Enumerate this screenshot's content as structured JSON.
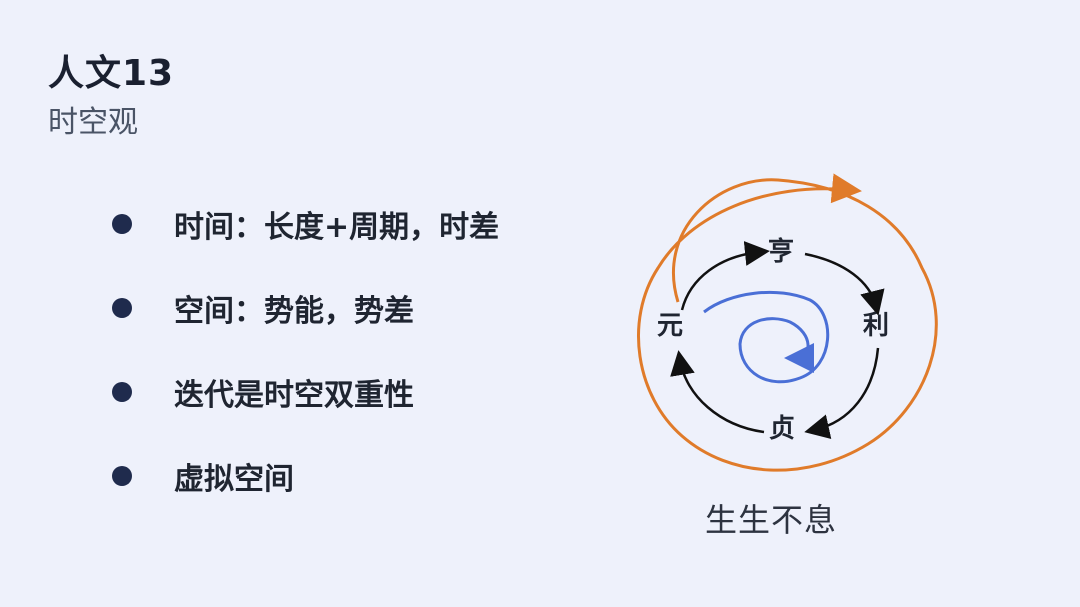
{
  "header": {
    "title": "人文13",
    "subtitle": "时空观"
  },
  "bullets": [
    {
      "text": "时间：长度+周期，时差"
    },
    {
      "text": "空间：势能，势差"
    },
    {
      "text": "迭代是时空双重性"
    },
    {
      "text": "虚拟空间"
    }
  ],
  "diagram": {
    "labels": {
      "yuan": "元",
      "heng": "亨",
      "li": "利",
      "zhen": "贞"
    },
    "caption": "生生不息",
    "colors": {
      "outer_spiral": "#e07b2a",
      "inner_cycle": "#111111",
      "center_spiral": "#4a6fd6"
    }
  }
}
